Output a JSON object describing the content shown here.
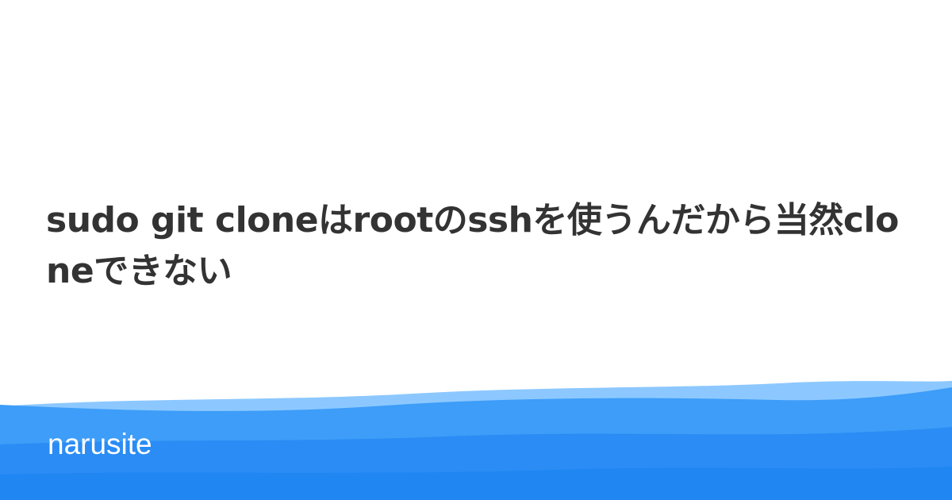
{
  "article": {
    "title": "sudo git cloneはrootのsshを使うんだから当然cloneできない"
  },
  "footer": {
    "site_name": "narusite"
  },
  "colors": {
    "background": "#ffffff",
    "title_text": "#333333",
    "wave_light": "#7fc3ff",
    "wave_mid": "#3d9df8",
    "wave_dark": "#1f86f2",
    "site_name_text": "#ffffff"
  }
}
